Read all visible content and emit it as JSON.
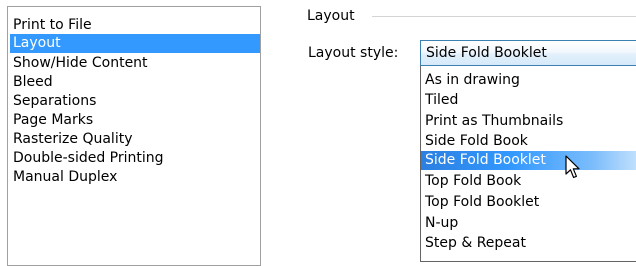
{
  "categories": {
    "items": [
      {
        "label": "Print to File",
        "selected": false
      },
      {
        "label": "Layout",
        "selected": true
      },
      {
        "label": "Show/Hide Content",
        "selected": false
      },
      {
        "label": "Bleed",
        "selected": false
      },
      {
        "label": "Separations",
        "selected": false
      },
      {
        "label": "Page Marks",
        "selected": false
      },
      {
        "label": "Rasterize Quality",
        "selected": false
      },
      {
        "label": "Double-sided Printing",
        "selected": false
      },
      {
        "label": "Manual Duplex",
        "selected": false
      }
    ]
  },
  "layout_group": {
    "title": "Layout",
    "style_label": "Layout style:",
    "selected_value": "Side Fold Booklet",
    "options": [
      {
        "label": "As in drawing",
        "selected": false
      },
      {
        "label": "Tiled",
        "selected": false
      },
      {
        "label": "Print as Thumbnails",
        "selected": false
      },
      {
        "label": "Side Fold Book",
        "selected": false
      },
      {
        "label": "Side Fold Booklet",
        "selected": true
      },
      {
        "label": "Top Fold Book",
        "selected": false
      },
      {
        "label": "Top Fold Booklet",
        "selected": false
      },
      {
        "label": "N-up",
        "selected": false
      },
      {
        "label": "Step & Repeat",
        "selected": false
      }
    ]
  },
  "cursor": {
    "icon": "arrow-cursor-icon"
  },
  "colors": {
    "selection": "#3399ff",
    "selection_text": "#ffffff",
    "combo_border": "#3c7fb1"
  }
}
